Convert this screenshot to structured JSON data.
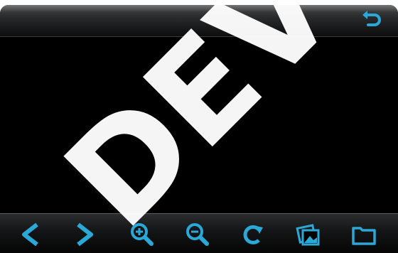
{
  "colors": {
    "accent": "#2aa8d8",
    "background": "#000000",
    "watermark": "#ffffff"
  },
  "top_bar": {
    "back_icon": "back-arrow-icon"
  },
  "toolbar": {
    "buttons": [
      {
        "name": "previous-button",
        "icon": "chevron-left-icon"
      },
      {
        "name": "next-button",
        "icon": "chevron-right-icon"
      },
      {
        "name": "zoom-in-button",
        "icon": "zoom-in-icon"
      },
      {
        "name": "zoom-out-button",
        "icon": "zoom-out-icon"
      },
      {
        "name": "rotate-button",
        "icon": "rotate-icon"
      },
      {
        "name": "set-wallpaper-button",
        "icon": "picture-frame-icon"
      },
      {
        "name": "folder-button",
        "icon": "folder-icon"
      }
    ]
  },
  "watermark": {
    "text": "DEV"
  }
}
